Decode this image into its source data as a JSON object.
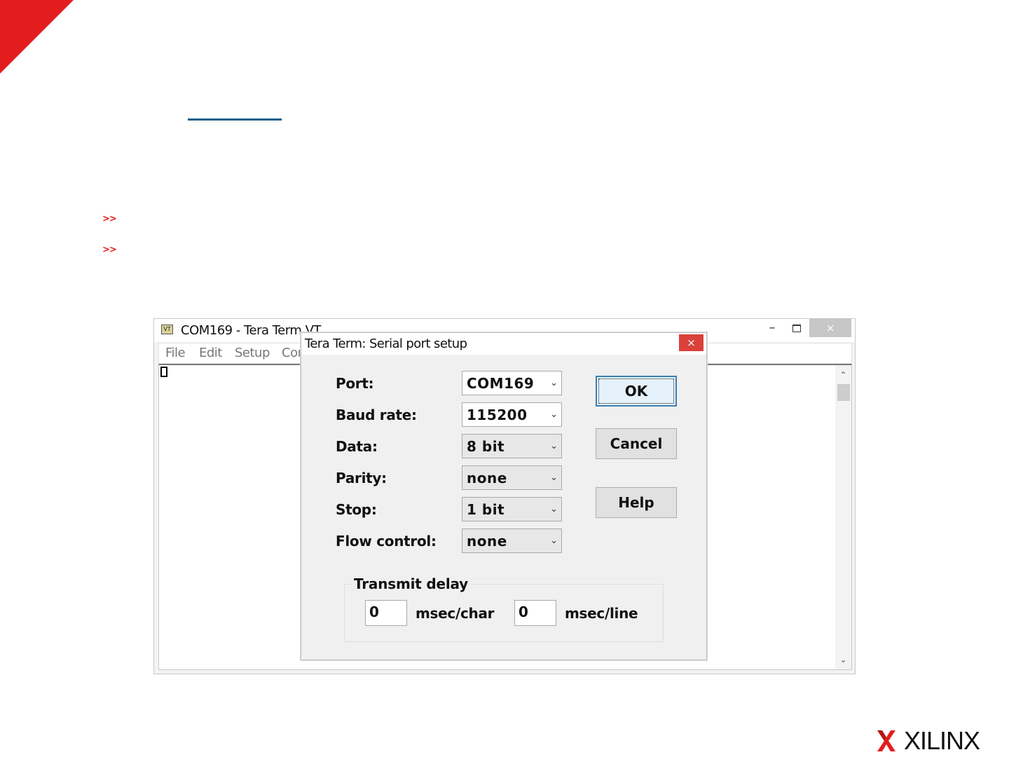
{
  "slide": {
    "bullets": [
      ">>",
      ">>"
    ]
  },
  "teraterm": {
    "icon_text": "VT",
    "window_title": "COM169 - Tera Term VT",
    "window_buttons": {
      "minimize": "–",
      "close": "×"
    },
    "menu": [
      "File",
      "Edit",
      "Setup",
      "Control"
    ],
    "scrollbar": {
      "up": "⌃",
      "down": "⌄"
    }
  },
  "dialog": {
    "title": "Tera Term: Serial port setup",
    "close": "×",
    "fields": [
      {
        "label": "Port:",
        "value": "COM169"
      },
      {
        "label": "Baud rate:",
        "value": "115200"
      },
      {
        "label": "Data:",
        "value": "8 bit"
      },
      {
        "label": "Parity:",
        "value": "none"
      },
      {
        "label": "Stop:",
        "value": "1 bit"
      },
      {
        "label": "Flow control:",
        "value": "none"
      }
    ],
    "dropdown_arrow": "⌄",
    "buttons": {
      "ok": "OK",
      "cancel": "Cancel",
      "help": "Help"
    },
    "transmit_delay": {
      "label": "Transmit delay",
      "char_value": "0",
      "char_unit": "msec/char",
      "line_value": "0",
      "line_unit": "msec/line"
    }
  },
  "logo": {
    "text": "XILINX"
  },
  "colors": {
    "accent_red": "#e31d1d",
    "title_underline": "#1b5f8c",
    "dialog_close": "#d9413a",
    "ok_border": "#3c7fb1"
  }
}
